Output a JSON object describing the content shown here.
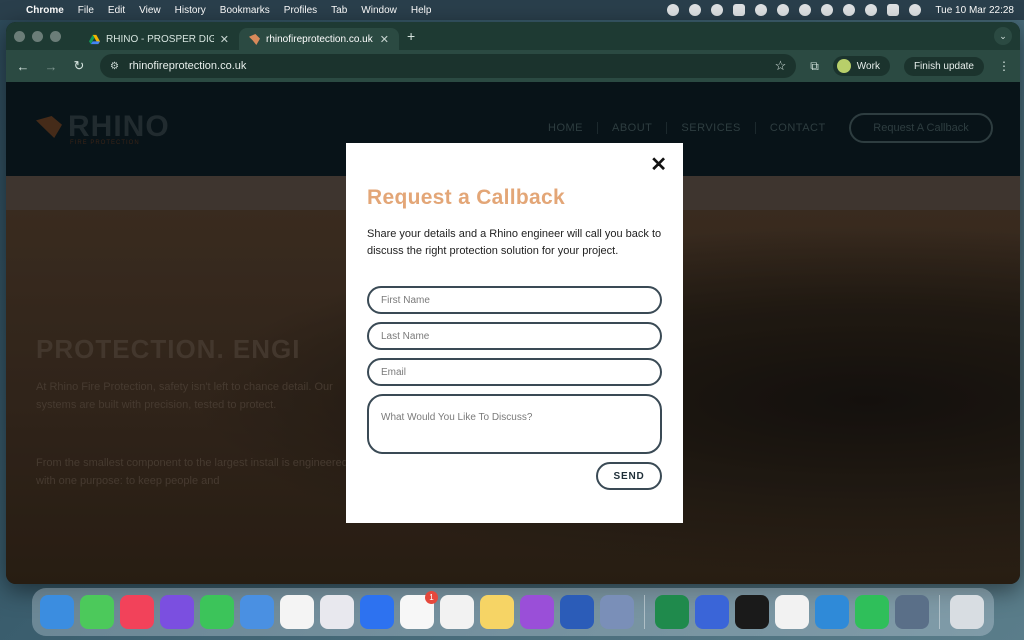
{
  "menubar": {
    "app": "Chrome",
    "items": [
      "File",
      "Edit",
      "View",
      "History",
      "Bookmarks",
      "Profiles",
      "Tab",
      "Window",
      "Help"
    ],
    "clock": "Tue 10 Mar  22:28"
  },
  "browser": {
    "tabs": [
      {
        "title": "RHINO - PROSPER DIGITAL -",
        "active": false
      },
      {
        "title": "rhinofireprotection.co.uk",
        "active": true
      }
    ],
    "url": "rhinofireprotection.co.uk",
    "profile": "Work",
    "update": "Finish update"
  },
  "site": {
    "logo": "RHINO",
    "logo_sub": "FIRE PROTECTION",
    "nav": [
      "HOME",
      "ABOUT",
      "SERVICES",
      "CONTACT"
    ],
    "cta": "Request A Callback",
    "hero_title": "PROTECTION. ENGI",
    "hero_p1": "At Rhino Fire Protection, safety isn't left to chance detail. Our systems are built with precision, tested to protect.",
    "hero_p2": "From the smallest component to the largest install is engineered with one purpose: to keep people and"
  },
  "modal": {
    "title": "Request a Callback",
    "description": "Share your details and a Rhino engineer will call you back to discuss the right protection solution for your project.",
    "first_name": "First Name",
    "last_name": "Last Name",
    "email": "Email",
    "message": "What Would You Like To Discuss?",
    "send": "SEND",
    "close": "✕"
  },
  "dock": {
    "apps": [
      {
        "name": "finder",
        "color": "#3b8de0"
      },
      {
        "name": "messages",
        "color": "#4cc95b"
      },
      {
        "name": "music",
        "color": "#f2425a"
      },
      {
        "name": "canva",
        "color": "#7b4fe0"
      },
      {
        "name": "facetime",
        "color": "#3cc45a"
      },
      {
        "name": "mail",
        "color": "#4a90e2"
      },
      {
        "name": "chatgpt",
        "color": "#f4f4f4"
      },
      {
        "name": "launchpad",
        "color": "#e8e8ee"
      },
      {
        "name": "zoom",
        "color": "#2d72f0"
      },
      {
        "name": "reminders",
        "color": "#f7f7f7"
      },
      {
        "name": "chrome",
        "color": "#f2f2f2"
      },
      {
        "name": "notes",
        "color": "#f6d465"
      },
      {
        "name": "podcasts",
        "color": "#9a4fd8"
      },
      {
        "name": "word",
        "color": "#2b5cb8"
      },
      {
        "name": "preview",
        "color": "#7a8fb8"
      },
      {
        "name": "excel",
        "color": "#1f8a4c"
      },
      {
        "name": "nordvpn",
        "color": "#3a65d8"
      },
      {
        "name": "spotify",
        "color": "#1a1a1a"
      },
      {
        "name": "sheet",
        "color": "#f2f2f2"
      },
      {
        "name": "quicktime",
        "color": "#2f8ad8"
      },
      {
        "name": "numbers",
        "color": "#2fbf5a"
      },
      {
        "name": "misc",
        "color": "#5a6f88"
      },
      {
        "name": "trash",
        "color": "#d8dde2"
      }
    ],
    "reminders_badge": "1"
  }
}
